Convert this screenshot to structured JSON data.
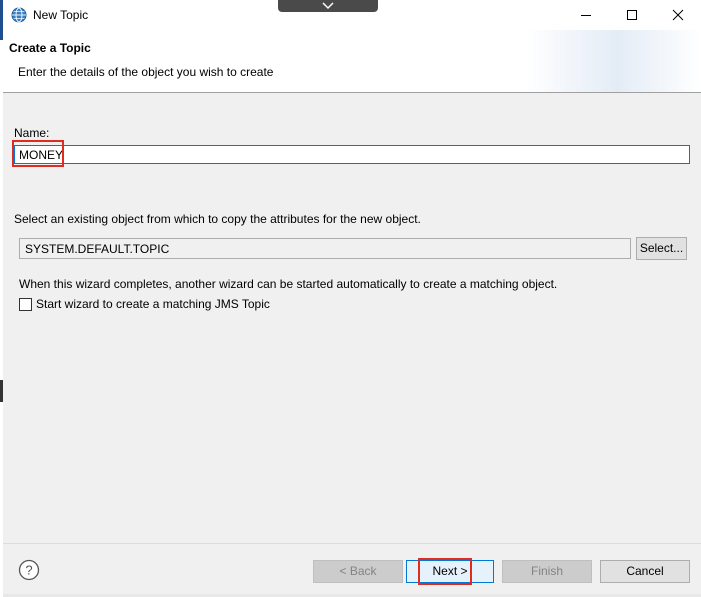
{
  "window": {
    "title": "New Topic"
  },
  "header": {
    "title": "Create a Topic",
    "description": "Enter the details of the object you wish to create"
  },
  "form": {
    "name_label": "Name:",
    "name_value": "MONEY",
    "copy_label": "Select an existing object from which to copy the attributes for the new object.",
    "copy_value": "SYSTEM.DEFAULT.TOPIC",
    "select_button": "Select...",
    "wizard_text": "When this wizard completes, another wizard can be started automatically to create a matching object.",
    "jms_checkbox_label": "Start wizard to create a matching JMS Topic",
    "jms_checkbox_checked": false
  },
  "buttons": {
    "back": "< Back",
    "next": "Next >",
    "finish": "Finish",
    "cancel": "Cancel"
  },
  "colors": {
    "highlight": "#e02c1e",
    "focus_border": "#0078d7"
  }
}
